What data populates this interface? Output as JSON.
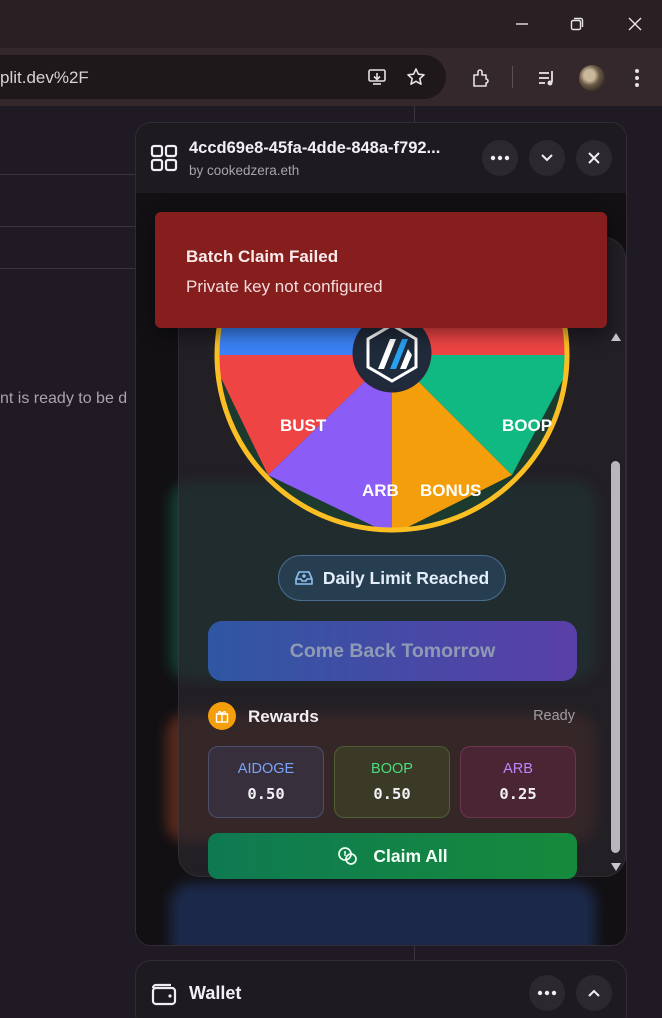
{
  "browser": {
    "url_fragment": "plit.dev%2F",
    "window_buttons": [
      "minimize-icon",
      "restore-icon",
      "close-icon"
    ],
    "toolbar_icons": [
      "install-app-icon",
      "star-icon",
      "extensions-icon",
      "media-icon",
      "avatar",
      "menu-icon"
    ]
  },
  "background_page": {
    "text": "nt is ready to be d"
  },
  "panel": {
    "title": "4ccd69e8-45fa-4dde-848a-f792...",
    "subtitle": "by cookedzera.eth"
  },
  "toast": {
    "title": "Batch Claim Failed",
    "message": "Private key not configured"
  },
  "wheel": {
    "segments": [
      {
        "label": "BUST",
        "color": "#ef4444"
      },
      {
        "label": "ARB",
        "color": "#8b5cf6"
      },
      {
        "label": "BONUS",
        "color": "#f59e0b"
      },
      {
        "label": "BOOP",
        "color": "#10b981"
      }
    ],
    "rim_color": "#fbbf24",
    "top_colors": [
      "#3b82f6",
      "#ef4444"
    ]
  },
  "status_badge": {
    "label": "Daily Limit Reached"
  },
  "cta": {
    "label": "Come Back Tomorrow"
  },
  "rewards": {
    "label": "Rewards",
    "status": "Ready",
    "tokens": [
      {
        "name": "AIDOGE",
        "value": "0.50",
        "color": "#7aa2f7"
      },
      {
        "name": "BOOP",
        "value": "0.50",
        "color": "#4ade80"
      },
      {
        "name": "ARB",
        "value": "0.25",
        "color": "#c084fc"
      }
    ],
    "claim_label": "Claim All"
  },
  "wallet": {
    "label": "Wallet"
  }
}
